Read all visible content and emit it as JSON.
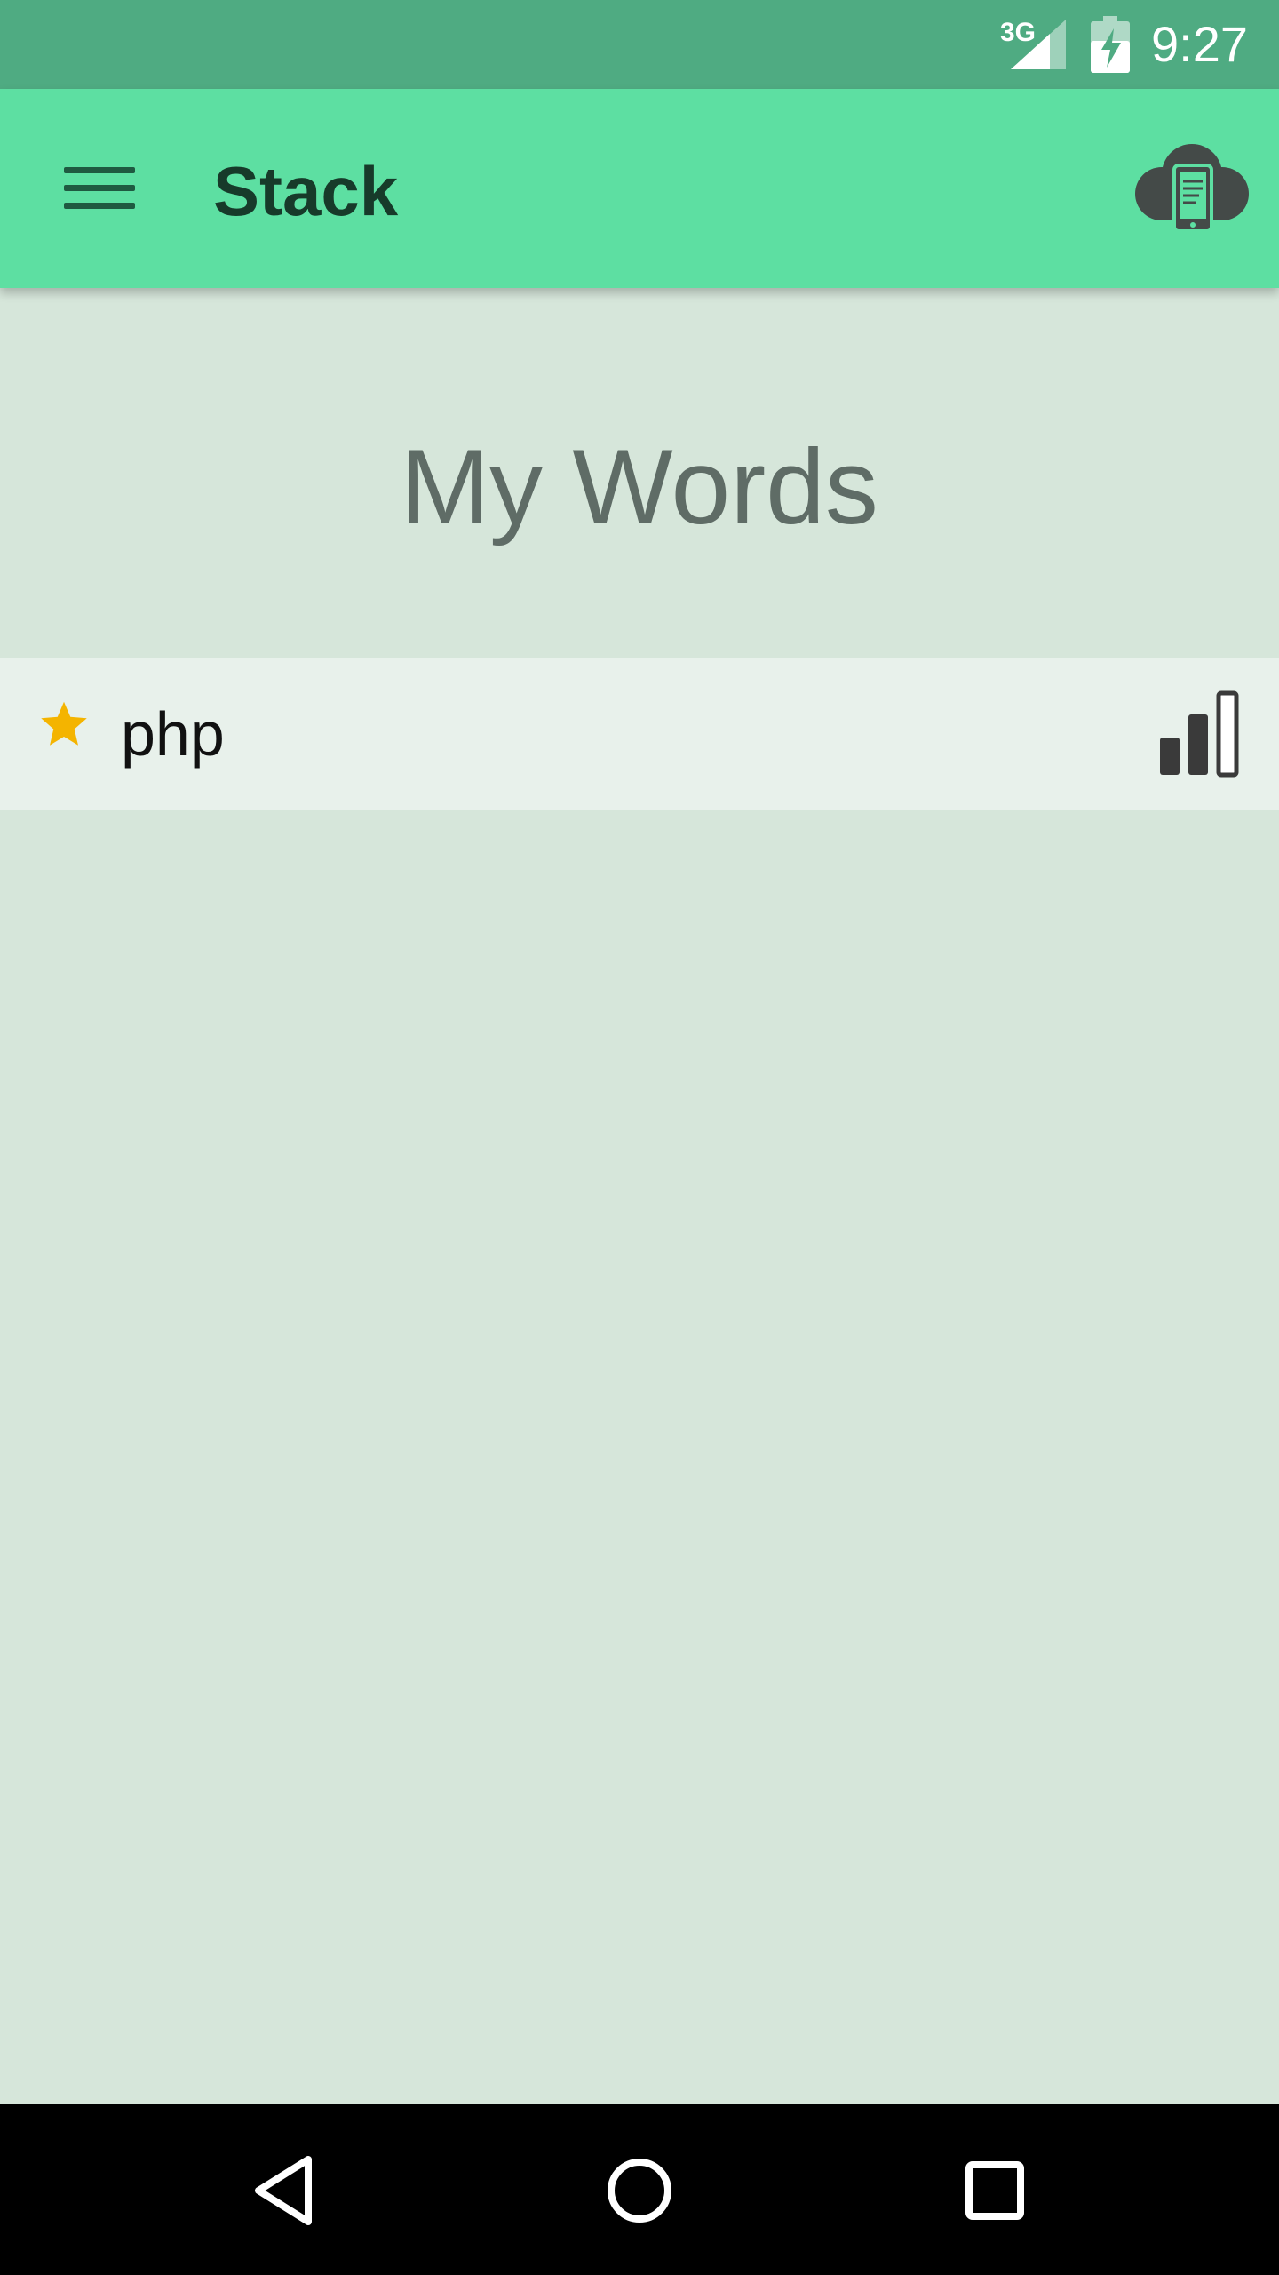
{
  "status_bar": {
    "network": "3G",
    "time": "9:27",
    "icons": [
      "signal-icon",
      "battery-charging-icon"
    ]
  },
  "app_bar": {
    "title": "Stack",
    "menu_icon": "hamburger-menu-icon",
    "action_icon": "cloud-device-icon"
  },
  "main": {
    "heading": "My Words",
    "words": [
      {
        "label": "php",
        "starred": true,
        "level_icon": "level-bars-icon"
      }
    ]
  },
  "nav_bar": {
    "icons": [
      "back-icon",
      "home-icon",
      "recents-icon"
    ]
  },
  "colors": {
    "status_bar": "#4fab82",
    "app_bar": "#5ddfa2",
    "background": "#d6e6da",
    "list_row": "#e8f1eb",
    "star": "#f4b400"
  }
}
